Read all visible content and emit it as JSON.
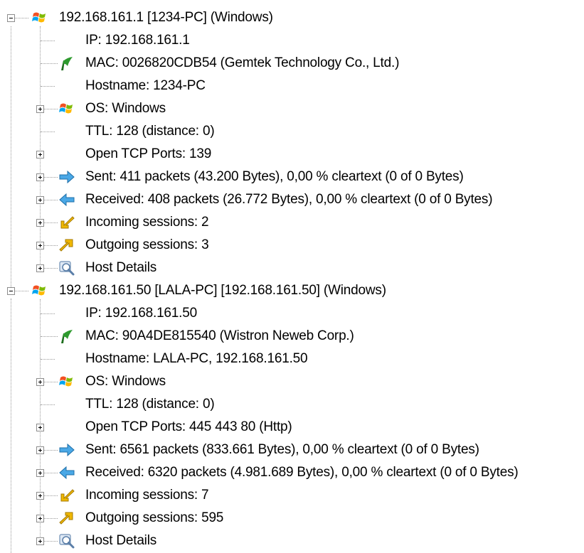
{
  "hosts": [
    {
      "title": "192.168.161.1 [1234-PC] (Windows)",
      "ip": "IP: 192.168.161.1",
      "mac": "MAC: 0026820CDB54 (Gemtek Technology Co., Ltd.)",
      "hostname": "Hostname: 1234-PC",
      "os": "OS: Windows",
      "ttl": "TTL: 128 (distance: 0)",
      "ports": "Open TCP Ports: 139",
      "sent": "Sent: 411 packets (43.200 Bytes), 0,00 % cleartext (0 of 0 Bytes)",
      "received": "Received: 408 packets (26.772 Bytes), 0,00 % cleartext (0 of 0 Bytes)",
      "incoming": "Incoming sessions: 2",
      "outgoing": "Outgoing sessions: 3",
      "details": "Host Details"
    },
    {
      "title": "192.168.161.50 [LALA-PC] [192.168.161.50] (Windows)",
      "ip": "IP: 192.168.161.50",
      "mac": "MAC: 90A4DE815540 (Wistron Neweb Corp.)",
      "hostname": "Hostname: LALA-PC, 192.168.161.50",
      "os": "OS: Windows",
      "ttl": "TTL: 128 (distance: 0)",
      "ports": "Open TCP Ports: 445 443 80 (Http)",
      "sent": "Sent: 6561 packets (833.661 Bytes), 0,00 % cleartext (0 of 0 Bytes)",
      "received": "Received: 6320 packets (4.981.689 Bytes), 0,00 % cleartext (0 of 0 Bytes)",
      "incoming": "Incoming sessions: 7",
      "outgoing": "Outgoing sessions: 595",
      "details": "Host Details"
    }
  ],
  "icons": {
    "host": "windows-flag-icon",
    "mac": "green-check-flag-icon",
    "os": "windows-flag-icon",
    "sent": "arrow-right-icon",
    "received": "arrow-left-icon",
    "incoming": "incoming-arrow-icon",
    "outgoing": "outgoing-arrow-icon",
    "details": "magnifier-icon"
  },
  "colors": {
    "sent_arrow": "#4aa8e6",
    "received_arrow": "#4aa8e6",
    "incoming_arrow": "#f0b800",
    "outgoing_arrow": "#f0b800",
    "mac_flag": "#2e9a2e"
  }
}
